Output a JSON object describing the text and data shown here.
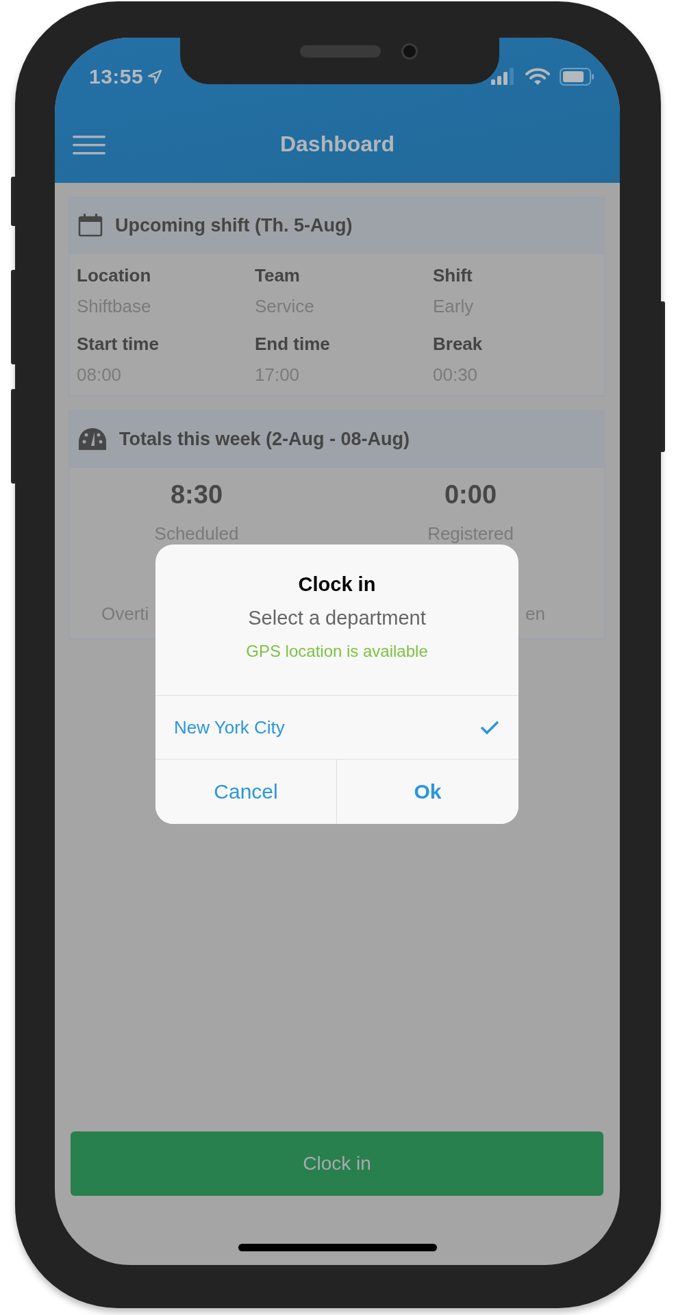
{
  "status_bar": {
    "time": "13:55"
  },
  "header": {
    "title": "Dashboard"
  },
  "upcoming_shift": {
    "title": "Upcoming shift (Th. 5-Aug)",
    "fields": [
      {
        "label": "Location",
        "value": "Shiftbase"
      },
      {
        "label": "Team",
        "value": "Service"
      },
      {
        "label": "Shift",
        "value": "Early"
      },
      {
        "label": "Start time",
        "value": "08:00"
      },
      {
        "label": "End time",
        "value": "17:00"
      },
      {
        "label": "Break",
        "value": "00:30"
      }
    ]
  },
  "totals": {
    "title": "Totals this week (2-Aug - 08-Aug)",
    "stats": [
      {
        "value": "8:30",
        "label": "Scheduled"
      },
      {
        "value": "0:00",
        "label": "Registered"
      }
    ],
    "partial_labels": [
      "Overti",
      "en"
    ]
  },
  "dialog": {
    "title": "Clock in",
    "subtitle": "Select a department",
    "gps_status": "GPS location is available",
    "options": [
      {
        "label": "New York City",
        "selected": true
      }
    ],
    "buttons": [
      {
        "label": "Cancel",
        "kind": "cancel"
      },
      {
        "label": "Ok",
        "kind": "confirm"
      }
    ]
  },
  "clock_in_button": {
    "label": "Clock in"
  }
}
